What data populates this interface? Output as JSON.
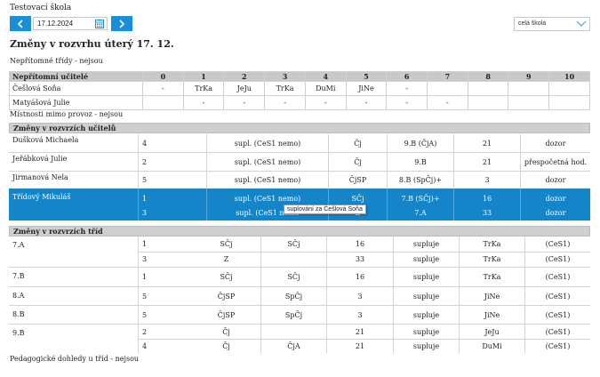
{
  "app": {
    "title": "Testovací škola"
  },
  "toolbar": {
    "date": "17.12.2024",
    "school_select": "celá škola"
  },
  "page_title": "Změny v rozvrhu úterý 17. 12.",
  "absent_classes": "Nepřítomné třídy - nejsou",
  "absent_teachers": {
    "header": "Nepřítomní učitelé",
    "periods": [
      "0",
      "1",
      "2",
      "3",
      "4",
      "5",
      "6",
      "7",
      "8",
      "9",
      "10"
    ],
    "rows": [
      {
        "name": "Češlová Soňa",
        "cells": [
          "-",
          "TrKa",
          "JeJu",
          "TrKa",
          "DuMi",
          "JiNe",
          "-",
          "",
          "",
          "",
          ""
        ]
      },
      {
        "name": "Matyášová Julie",
        "cells": [
          "",
          "-",
          "-",
          "-",
          "-",
          "-",
          "-",
          "-",
          "",
          "",
          ""
        ]
      }
    ]
  },
  "rooms_out": "Místnosti mimo provoz - nejsou",
  "teacher_changes": {
    "header": "Změny v rozvrzích učitelů",
    "rows": [
      {
        "name": "Dušková Michaela",
        "entries": [
          [
            "4",
            "supl. (CeS1 nemo)",
            "Čj",
            "9.B (ČjA)",
            "21",
            "dozor"
          ]
        ]
      },
      {
        "name": "Jeřábková Julie",
        "entries": [
          [
            "2",
            "supl. (CeS1 nemo)",
            "Čj",
            "9.B",
            "21",
            "přespočetná hod."
          ]
        ]
      },
      {
        "name": "Jirmanová Nela",
        "entries": [
          [
            "5",
            "supl. (CeS1 nemo)",
            "ČjSP",
            "8.B (SpČj)+",
            "3",
            "dozor"
          ]
        ]
      },
      {
        "name": "Třídový Mikuláš",
        "entries": [
          [
            "1",
            "supl. (CeS1 nemo)",
            "SČj",
            "7.B (SČj)+",
            "16",
            "dozor"
          ],
          [
            "3",
            "supl. (CeS1 nemo",
            "Z",
            "7.A",
            "33",
            "dozor"
          ]
        ]
      }
    ]
  },
  "class_changes": {
    "header": "Změny v rozvrzích tříd",
    "rows": [
      {
        "name": "7.A",
        "entries": [
          [
            "1",
            "SČj",
            "SČj",
            "16",
            "supluje",
            "TrKa",
            "(CeS1)"
          ],
          [
            "3",
            "Z",
            "",
            "33",
            "supluje",
            "TrKa",
            "(CeS1)"
          ]
        ]
      },
      {
        "name": "7.B",
        "entries": [
          [
            "1",
            "SČj",
            "SČj",
            "16",
            "supluje",
            "TrKa",
            "(CeS1)"
          ]
        ]
      },
      {
        "name": "8.A",
        "entries": [
          [
            "5",
            "ČjSP",
            "SpČj",
            "3",
            "supluje",
            "JiNe",
            "(CeS1)"
          ]
        ]
      },
      {
        "name": "8.B",
        "entries": [
          [
            "5",
            "ČjSP",
            "SpČj",
            "3",
            "supluje",
            "JiNe",
            "(CeS1)"
          ]
        ]
      },
      {
        "name": "9.B",
        "entries": [
          [
            "2",
            "Čj",
            "",
            "21",
            "supluje",
            "JeJu",
            "(CeS1)"
          ],
          [
            "4",
            "Čj",
            "ČjA",
            "21",
            "supluje",
            "DuMi",
            "(CeS1)"
          ]
        ]
      }
    ]
  },
  "supervision": "Pedagogické dohledy u tříd - nejsou",
  "tooltip": "suplování za Češlová Soňa",
  "colors": {
    "accent": "#1a8fd8",
    "selected_row": "#1485c9",
    "header_gray": "#c9c9c9"
  }
}
